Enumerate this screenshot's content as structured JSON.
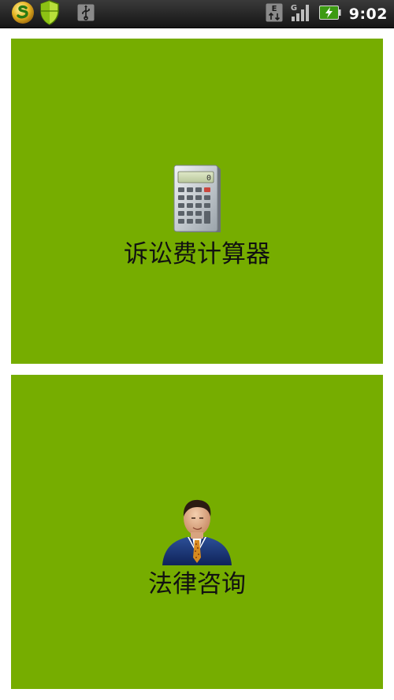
{
  "status_bar": {
    "time": "9:02",
    "network_type": "E",
    "signal_type": "G",
    "icons": [
      "app-logo-icon",
      "shield-icon",
      "usb-icon",
      "data-arrows-icon",
      "signal-icon",
      "battery-charging-icon"
    ]
  },
  "menu": {
    "items": [
      {
        "label": "诉讼费计算器",
        "icon": "calculator-icon"
      },
      {
        "label": "法律咨询",
        "icon": "lawyer-icon"
      }
    ]
  },
  "colors": {
    "panel": "#76ad00",
    "background": "#ffffff",
    "status_bar": "#1f1f1f",
    "text": "#111111"
  }
}
